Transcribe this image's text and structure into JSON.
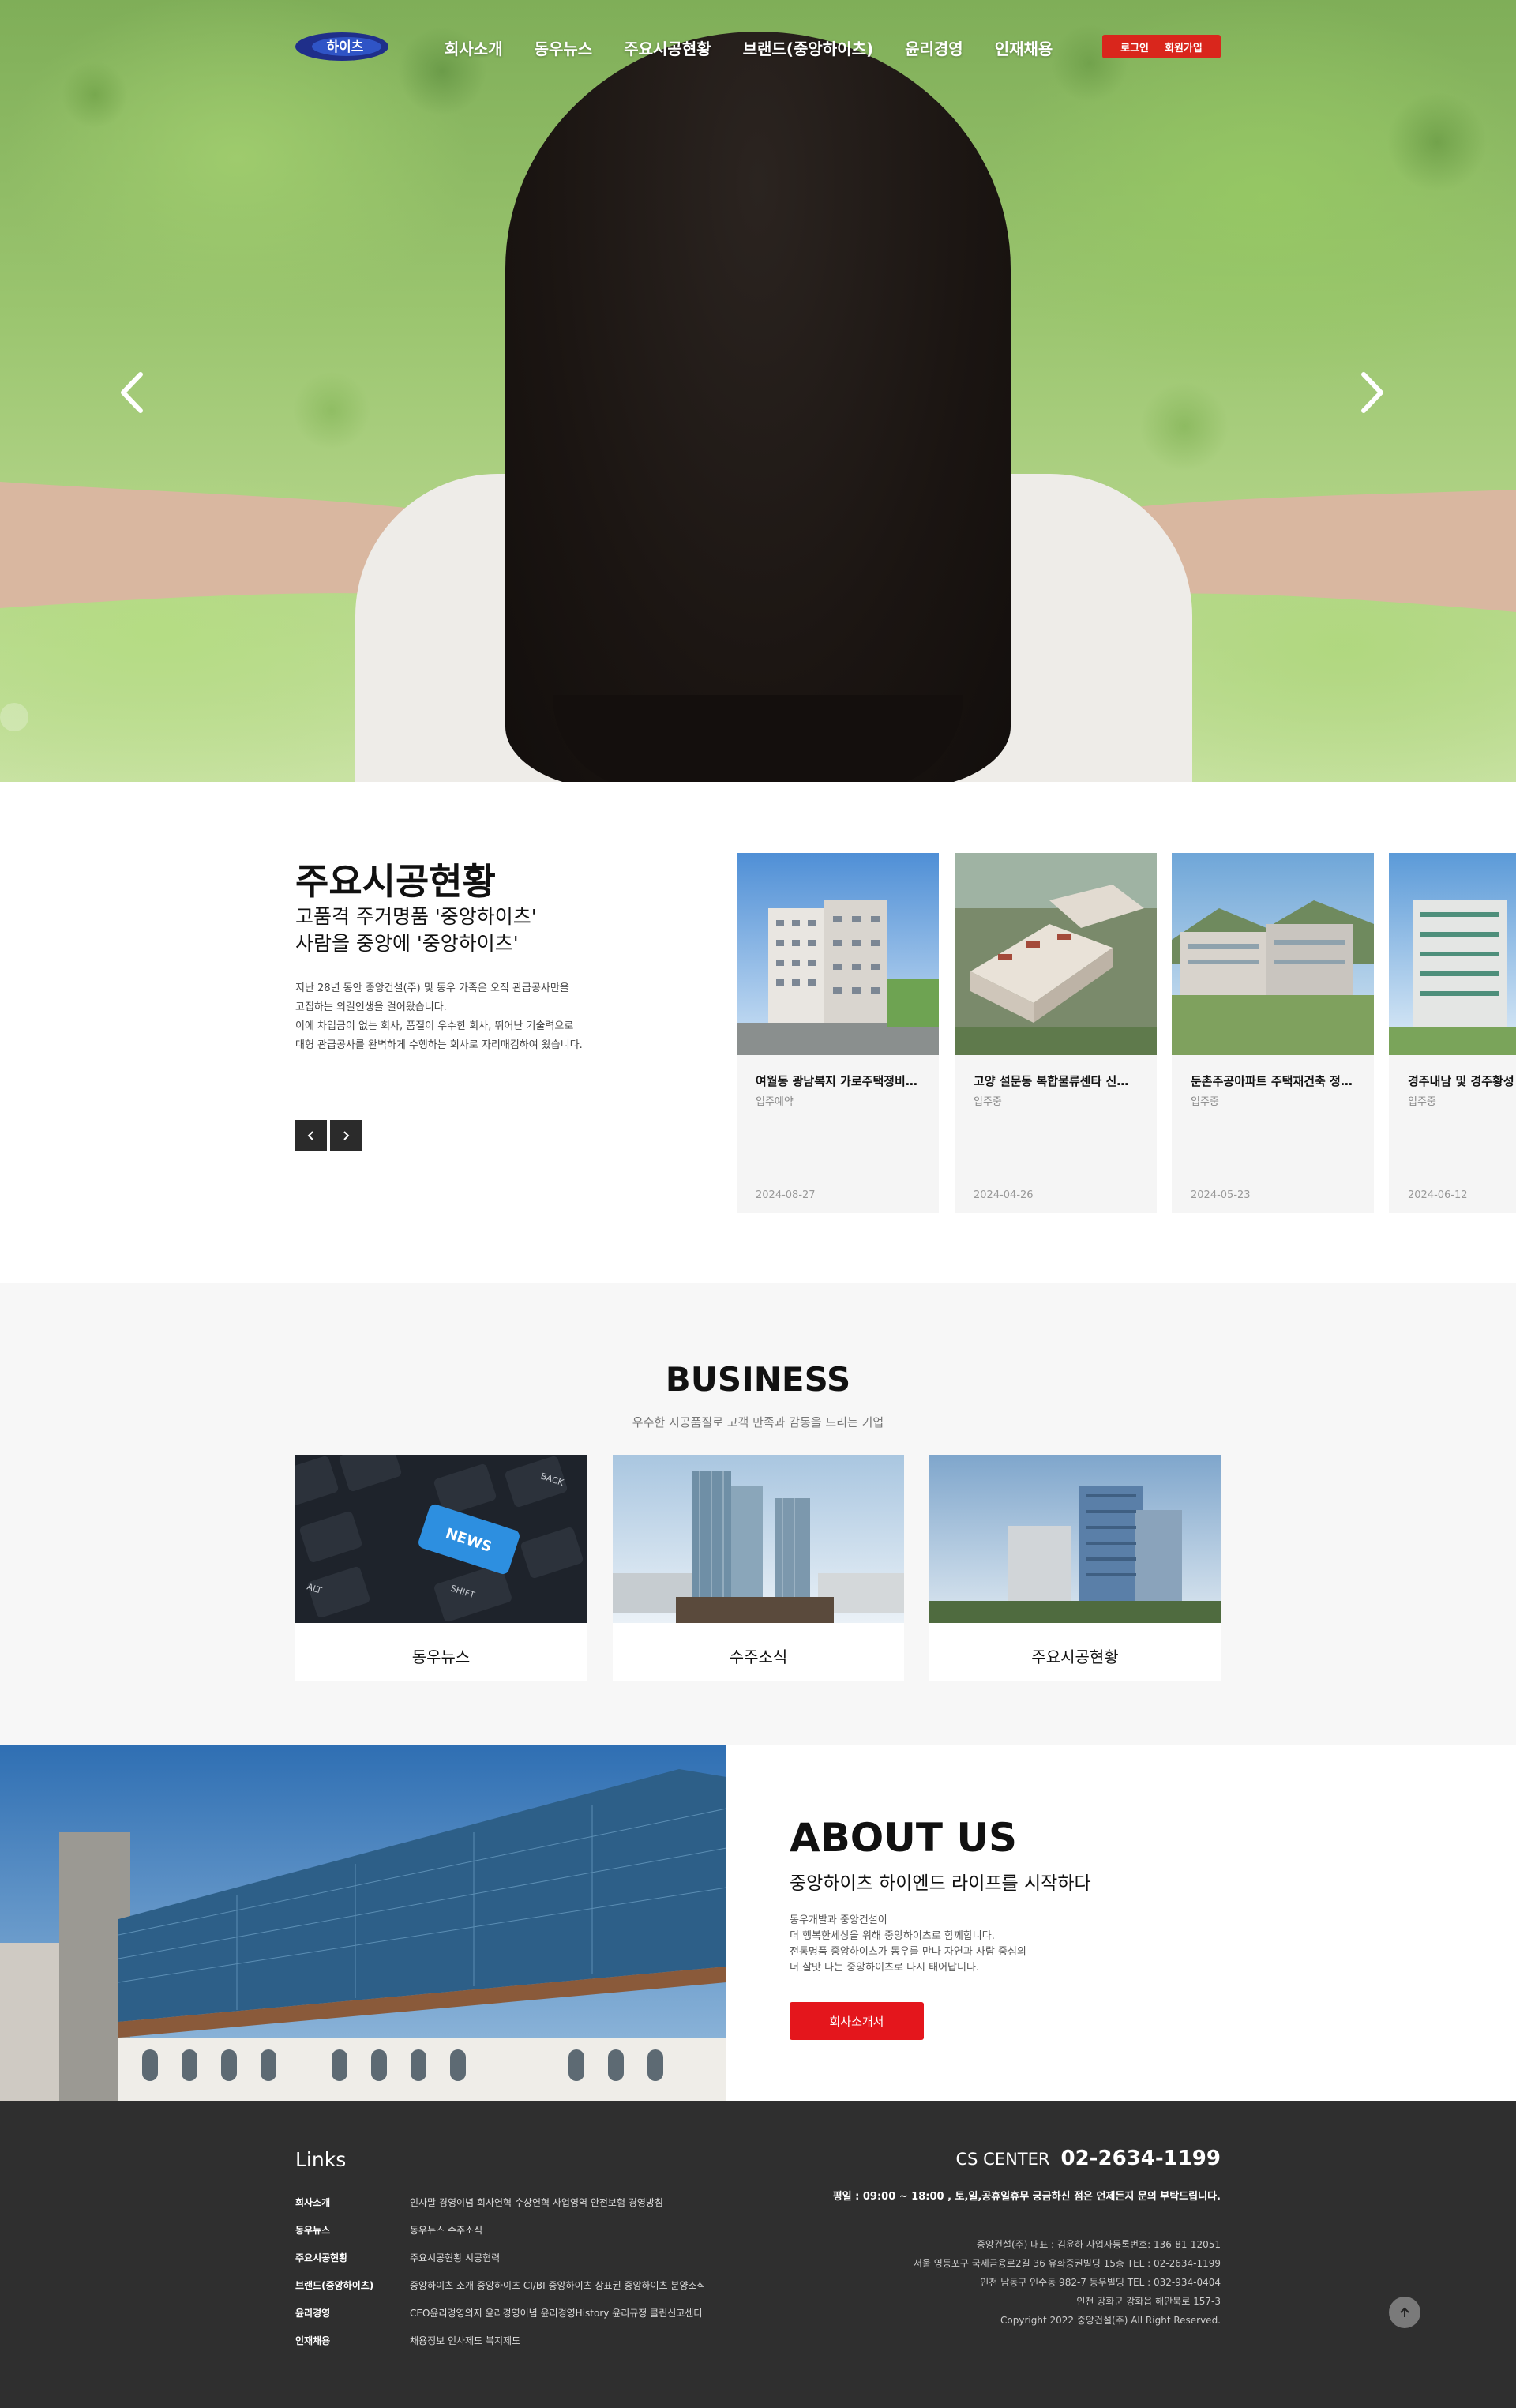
{
  "header": {
    "logo_text": "하이츠",
    "nav": [
      "회사소개",
      "동우뉴스",
      "주요시공현황",
      "브랜드(중앙하이츠)",
      "윤리경영",
      "인재채용"
    ],
    "login": "로그인",
    "signup": "회원가입"
  },
  "construction": {
    "title": "주요시공현황",
    "subtitle_1": "고품격 주거명품 '중앙하이츠'",
    "subtitle_2": "사람을 중앙에 '중앙하이츠'",
    "desc_1": "지난 28년 동안 중앙건설(주) 및 동우 가족은 오직 관급공사만을",
    "desc_2": "고집하는 외길인생을 걸어왔습니다.",
    "desc_3": "이에 차입금이 없는 회사, 품질이 우수한 회사, 뛰어난 기술력으로",
    "desc_4": "대형 관급공사를 완벽하게 수행하는 회사로 자리매김하여 왔습니다.",
    "cards": [
      {
        "title": "여월동 광남복지 가로주택정비사업",
        "status": "입주예약",
        "date": "2024-08-27"
      },
      {
        "title": "고양 설문동 복합물류센타 신축공사",
        "status": "입주중",
        "date": "2024-04-26"
      },
      {
        "title": "둔촌주공아파트 주택재건축 정비사업",
        "status": "입주중",
        "date": "2024-05-23"
      },
      {
        "title": "경주내남 및 경주황성",
        "status": "입주중",
        "date": "2024-06-12"
      }
    ]
  },
  "business": {
    "title": "BUSINESS",
    "subtitle": "우수한 시공품질로 고객 만족과 감동을 드리는 기업",
    "items": [
      "동우뉴스",
      "수주소식",
      "주요시공현황"
    ],
    "keyboard_key": "NEWS",
    "key_back": "BACK",
    "key_alt": "ALT",
    "key_shift": "SHIFT"
  },
  "about": {
    "title": "ABOUT US",
    "subtitle": "중앙하이츠 하이엔드 라이프를 시작하다",
    "desc_1": "동우개발과 중앙건설이",
    "desc_2": "더 행복한세상을 위해 중앙하이츠로 함께합니다.",
    "desc_3": "전통명품 중앙하이츠가 동우를 만나 자연과 사람 중심의",
    "desc_4": "더 살맛 나는 중앙하이츠로 다시 태어납니다.",
    "button": "회사소개서"
  },
  "footer": {
    "links_title": "Links",
    "links": [
      {
        "k": "회사소개",
        "v": "인사말 경영이념 회사연혁 수상연혁 사업영역 안전보험 경영방침"
      },
      {
        "k": "동우뉴스",
        "v": "동우뉴스 수주소식"
      },
      {
        "k": "주요시공현황",
        "v": "주요시공현황 시공협력"
      },
      {
        "k": "브랜드(중앙하이츠)",
        "v": "중앙하이츠 소개 중앙하이츠 CI/BI 중앙하이츠 상표권 중앙하이츠 분양소식"
      },
      {
        "k": "윤리경영",
        "v": "CEO윤리경영의지 윤리경영이념 윤리경영History 윤리규정 클린신고센터"
      },
      {
        "k": "인재채용",
        "v": "채용정보 인사제도 복지제도"
      }
    ],
    "cs_label": "CS CENTER",
    "cs_phone": "02-2634-1199",
    "hours": "평일 : 09:00 ~ 18:00 , 토,일,공휴일휴무 궁금하신 점은 언제든지 문의 부탁드립니다.",
    "info_1": "중앙건설(주) 대표 : 김윤하 사업자등록번호: 136-81-12051",
    "info_2": "서울 영등포구 국제금융로2길 36 유화증권빌딩 15층 TEL : 02-2634-1199",
    "info_3": "인천 남동구 인수동 982-7 동우빌딩 TEL : 032-934-0404",
    "info_4": "인천 강화군 강화읍 해안북로 157-3",
    "copyright": "Copyright 2022 중앙건설(주) All Right Reserved."
  }
}
